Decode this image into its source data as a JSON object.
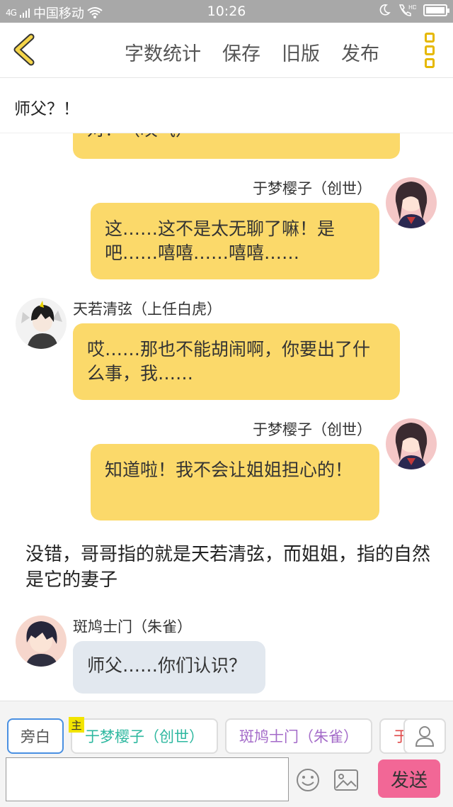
{
  "status_bar": {
    "network": "4G",
    "carrier": "中国移动",
    "time": "10:26",
    "hd": "HD"
  },
  "nav": {
    "actions": [
      "字数统计",
      "保存",
      "旧版",
      "发布"
    ],
    "accent_color": "#e6b800"
  },
  "title": "师父？！",
  "messages": [
    {
      "side": "right",
      "text": "对？（叹气）"
    },
    {
      "side": "right",
      "name": "于梦樱子（创世）",
      "text": "这……这不是太无聊了嘛！是吧……嘻嘻……嘻嘻……"
    },
    {
      "side": "left",
      "name": "天若清弦（上任白虎）",
      "text": "哎……那也不能胡闹啊，你要出了什么事，我……"
    },
    {
      "side": "right",
      "name": "于梦樱子（创世）",
      "text": "知道啦！我不会让姐姐担心的！"
    },
    {
      "side": "narration",
      "text": "没错，哥哥指的就是天若清弦，而姐姐，指的自然是它的妻子"
    },
    {
      "side": "left",
      "name": "斑鸠士门（朱雀）",
      "text": "师父……你们认识？"
    }
  ],
  "bottom": {
    "roles": [
      "旁白",
      "于梦樱子（创世）",
      "斑鸠士门（朱雀）",
      "于"
    ],
    "host_tag": "主",
    "send_label": "发送",
    "input_placeholder": ""
  },
  "colors": {
    "bubble_yellow": "#fbd96a",
    "bubble_gray": "#e2e8ef",
    "send_pink": "#f26796"
  }
}
